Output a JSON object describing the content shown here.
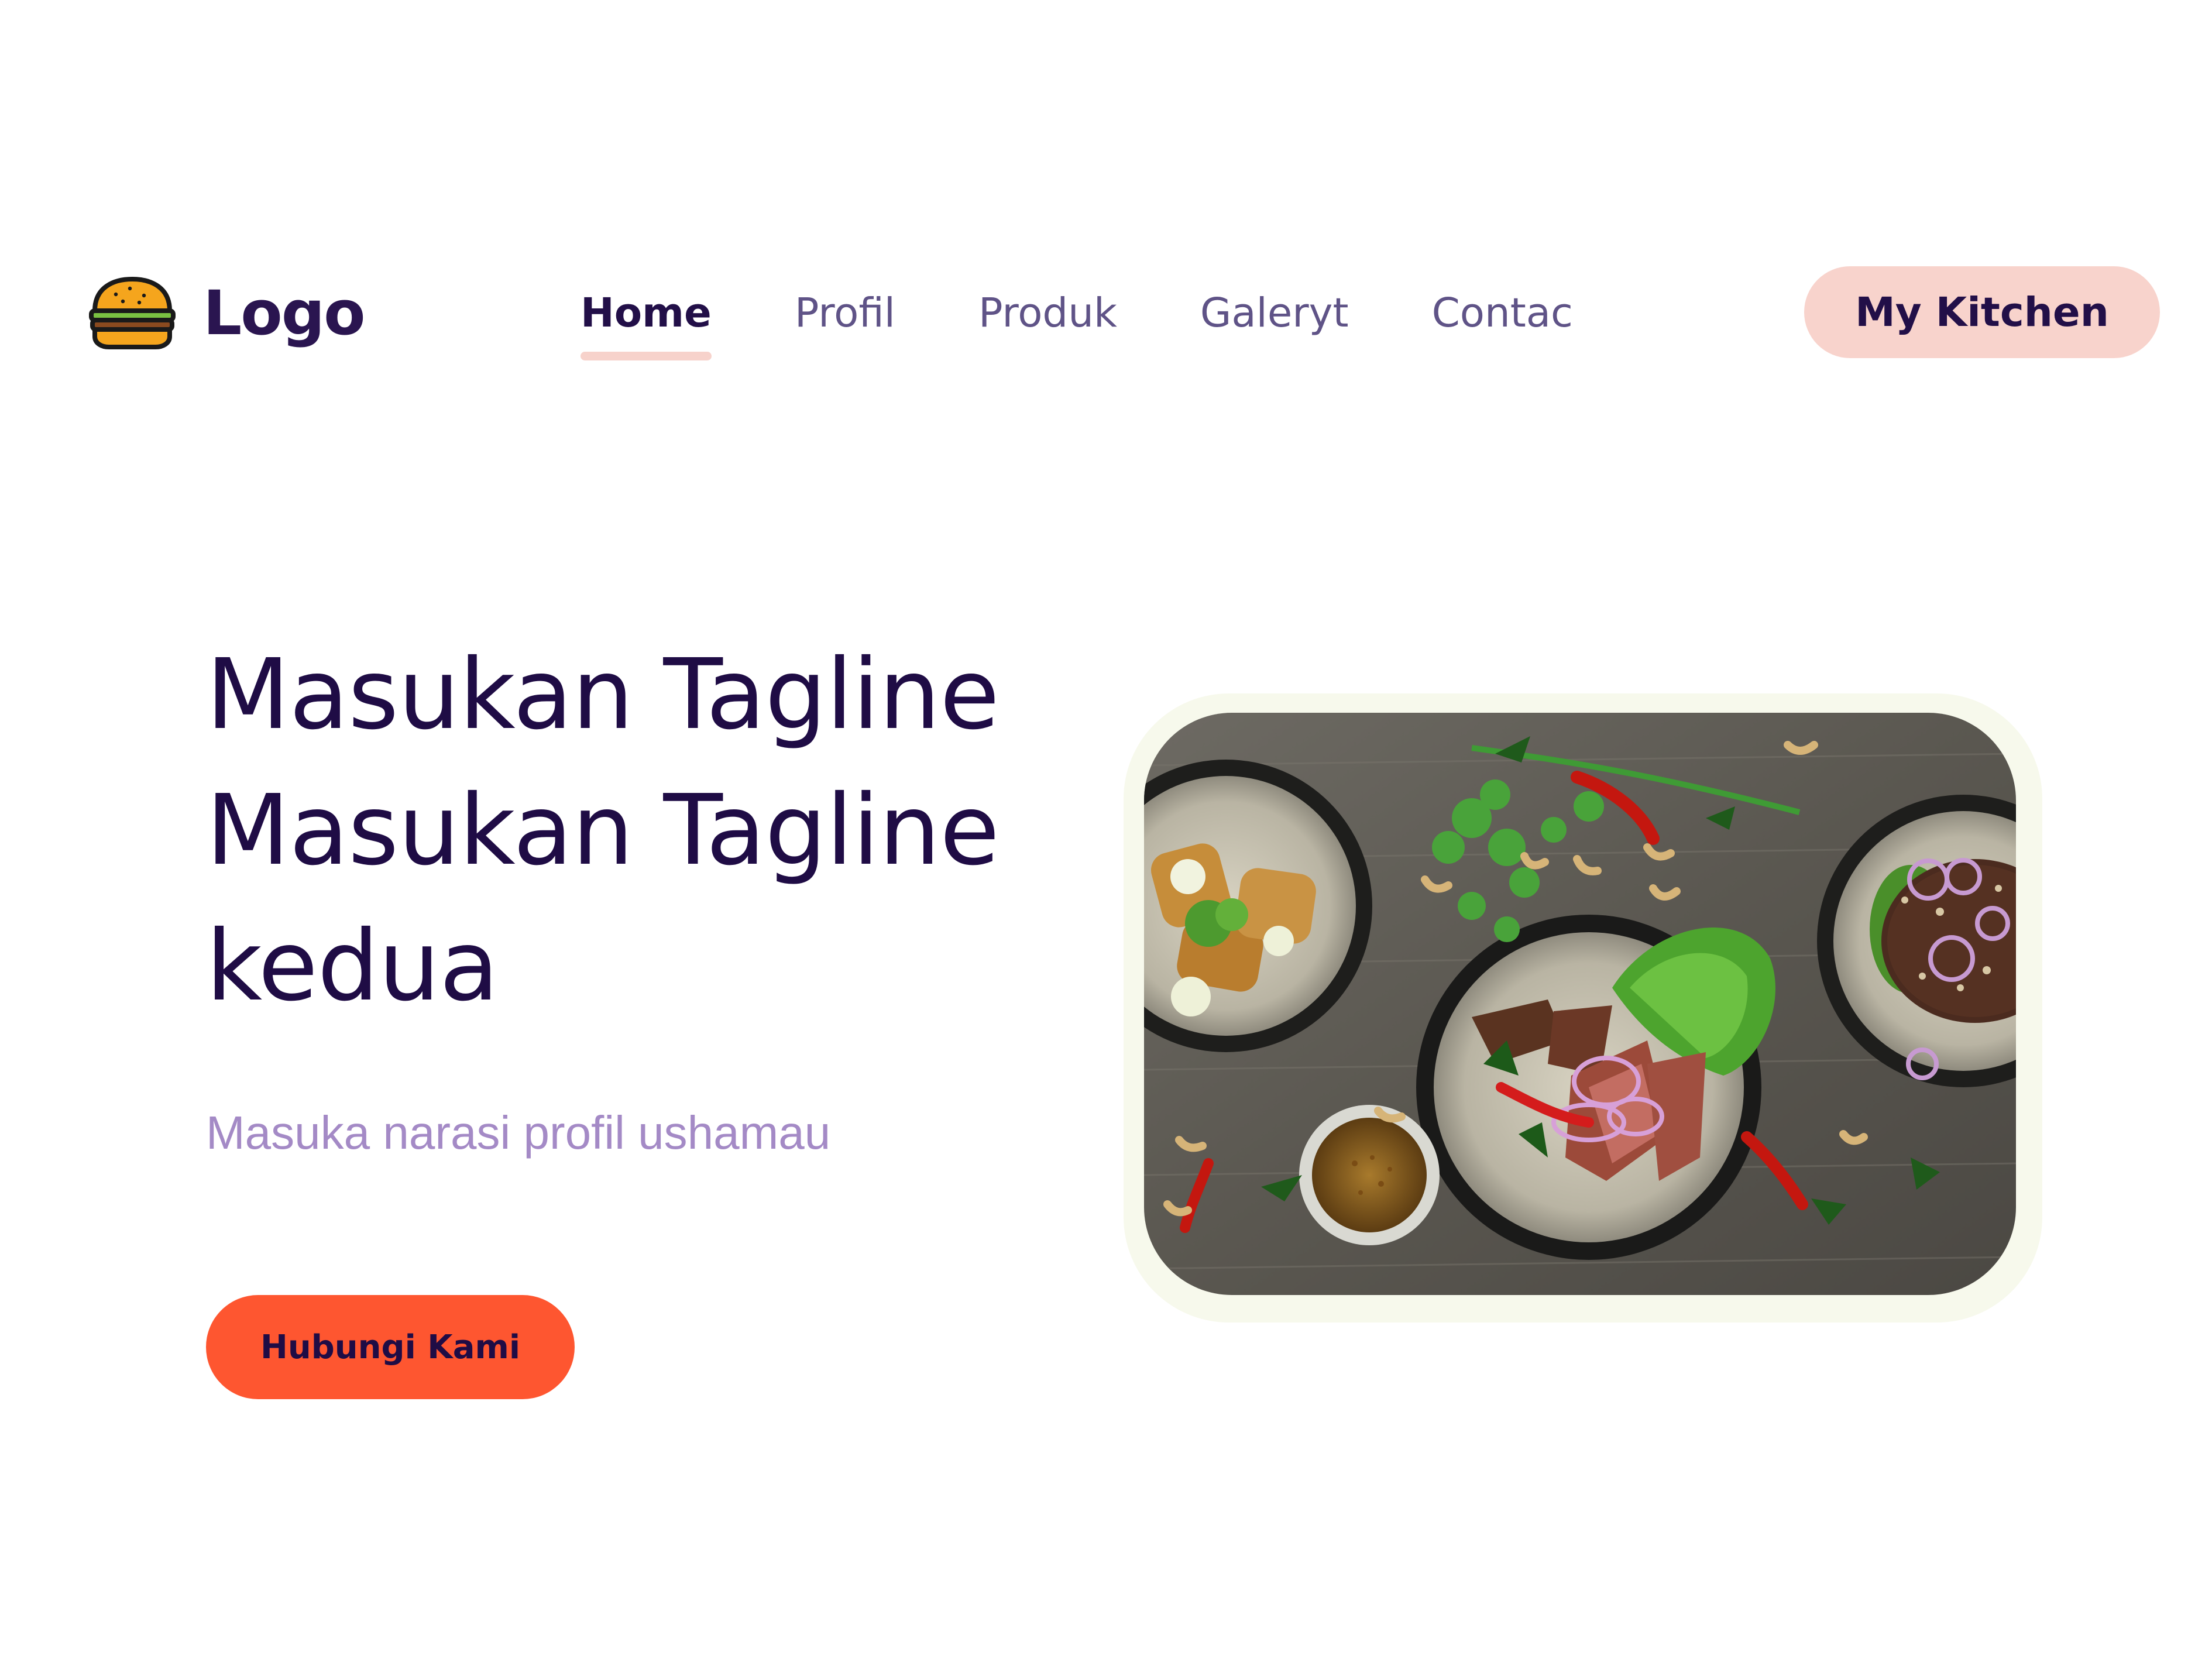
{
  "navbar": {
    "logo": {
      "text": "Logo",
      "icon": "burger-icon"
    },
    "items": [
      {
        "label": "Home",
        "active": true
      },
      {
        "label": "Profil",
        "active": false
      },
      {
        "label": "Produk",
        "active": false
      },
      {
        "label": "Galeryt",
        "active": false
      },
      {
        "label": "Contac",
        "active": false
      }
    ],
    "cta_label": "My Kitchen"
  },
  "hero": {
    "tagline_lines": [
      "Masukan Tagline",
      "Masukan Tagline",
      "kedua"
    ],
    "narasi": "Masuka narasi profil ushamau",
    "button_label": "Hubungi Kami",
    "image_icon": "food-photo"
  },
  "colors": {
    "primary_text": "#220f48",
    "nav_text": "#5f5387",
    "accent_pink": "#f8d3cc",
    "accent_orange": "#fe5630",
    "narasi_text": "#a48ac6",
    "image_frame": "#f7f9ec"
  }
}
